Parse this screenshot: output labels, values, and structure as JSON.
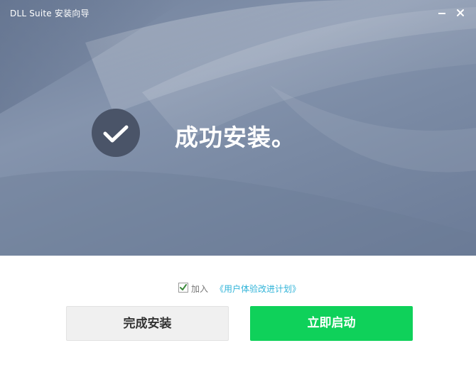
{
  "window": {
    "title": "DLL Suite 安装向导",
    "minimize_icon": "minimize-icon",
    "close_icon": "close-icon"
  },
  "hero": {
    "status_icon": "checkmark-icon",
    "message": "成功安装。"
  },
  "footer": {
    "consent": {
      "checked": true,
      "label": "加入",
      "link_text": "《用户体验改进计划》"
    },
    "buttons": {
      "finish_label": "完成安装",
      "launch_label": "立即启动"
    }
  },
  "colors": {
    "accent_green": "#0fd15a",
    "link_blue": "#2fb3d8",
    "hero_base": "#7a8aa4"
  }
}
